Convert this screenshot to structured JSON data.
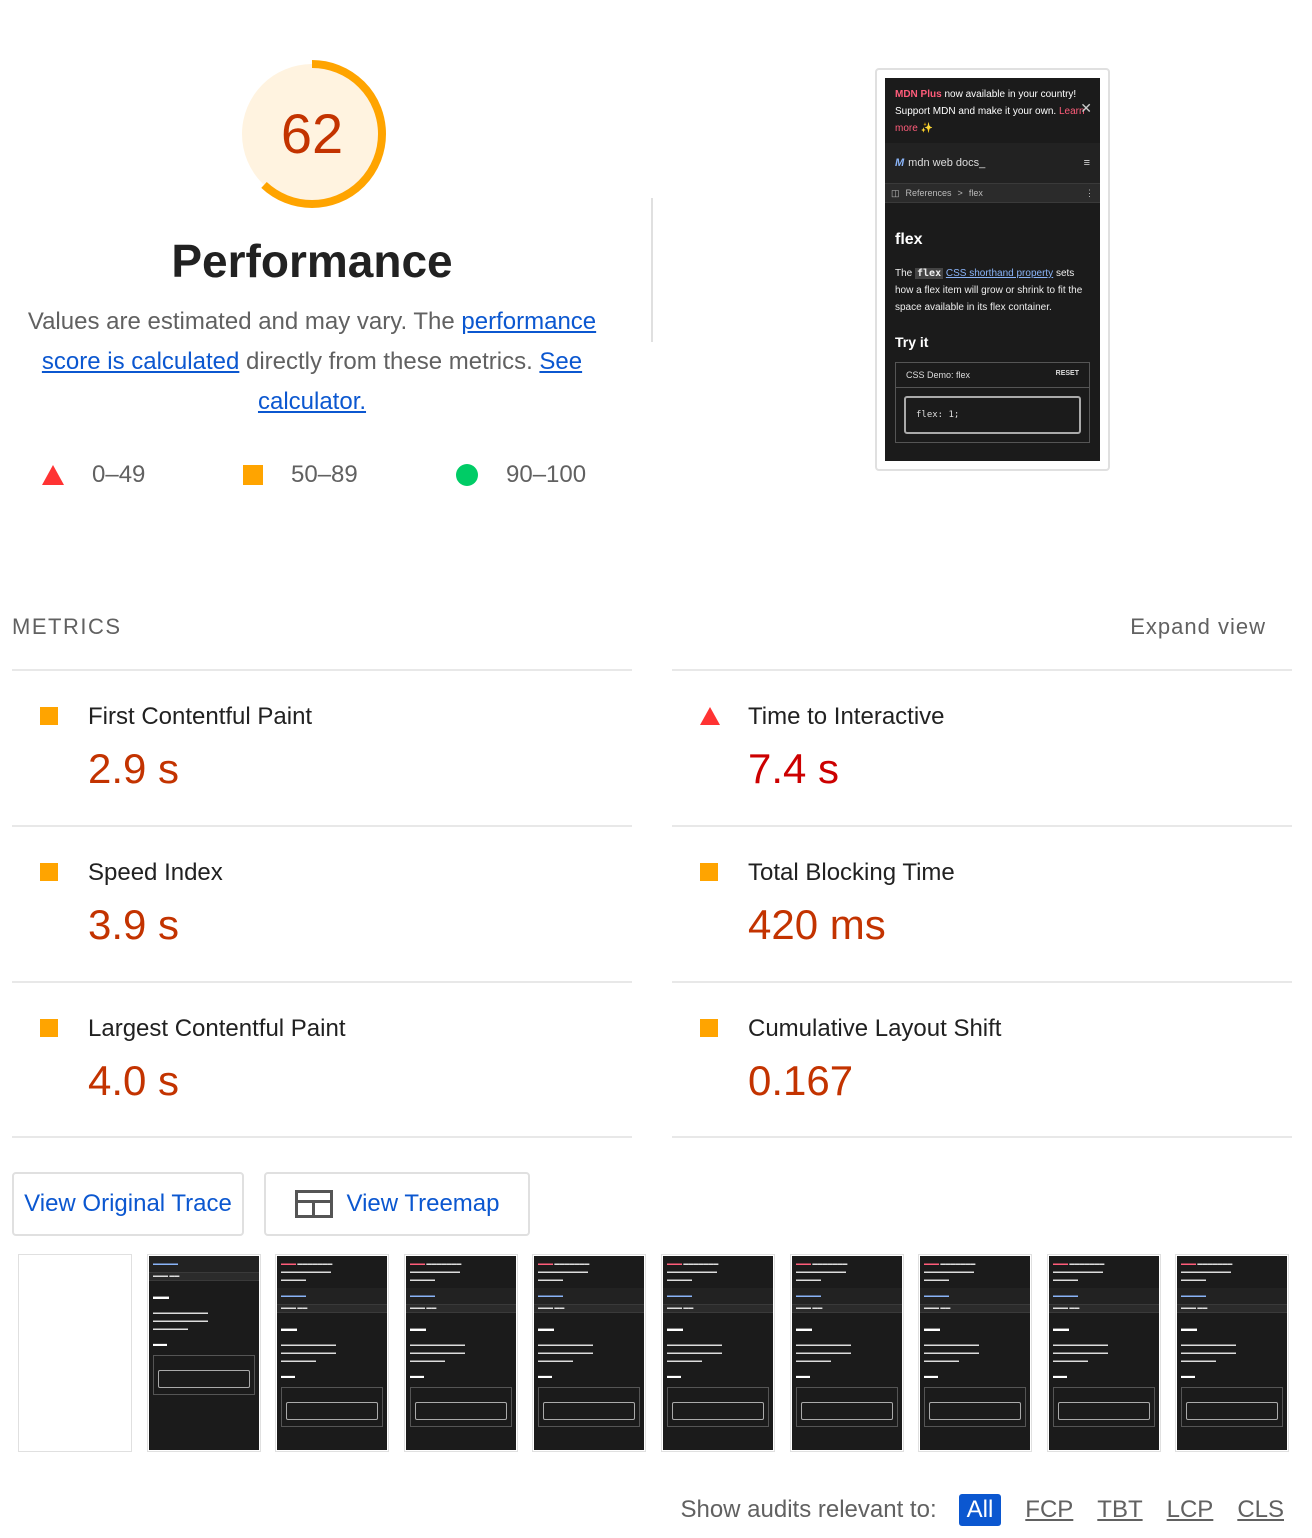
{
  "summary": {
    "score": "62",
    "score_fraction": 0.62,
    "title": "Performance",
    "desc_prefix": "Values are estimated and may vary. The ",
    "desc_link1": "performance score is calculated",
    "desc_middle": " directly from these metrics. ",
    "desc_link2": "See calculator."
  },
  "legend": [
    {
      "icon": "red-triangle",
      "range": "0–49"
    },
    {
      "icon": "orange-square",
      "range": "50–89"
    },
    {
      "icon": "green-circle",
      "range": "90–100"
    }
  ],
  "final_screenshot": {
    "banner_brand": "MDN Plus",
    "banner_text": " now available in your country! Support MDN and make it your own. ",
    "banner_link": "Learn more ✨",
    "close": "✕",
    "logo": "M",
    "logo_text": "mdn web docs_",
    "menu": "≡",
    "crumb_icon": "◫",
    "crumb_1": "References",
    "crumb_sep": ">",
    "crumb_2": "flex",
    "crumb_more": "⋮",
    "heading": "flex",
    "para_pre": "The ",
    "para_code": "flex",
    "para_link": "CSS shorthand property",
    "para_post": " sets how a flex item will grow or shrink to fit the space available in its flex container.",
    "try_it": "Try it",
    "demo_title": "CSS Demo: flex",
    "demo_reset": "RESET",
    "demo_code": "flex: 1;"
  },
  "metrics": {
    "section_label": "METRICS",
    "expand_label": "Expand view",
    "items": [
      {
        "name": "First Contentful Paint",
        "value": "2.9 s",
        "status": "average"
      },
      {
        "name": "Time to Interactive",
        "value": "7.4 s",
        "status": "fail"
      },
      {
        "name": "Speed Index",
        "value": "3.9 s",
        "status": "average"
      },
      {
        "name": "Total Blocking Time",
        "value": "420 ms",
        "status": "average"
      },
      {
        "name": "Largest Contentful Paint",
        "value": "4.0 s",
        "status": "average"
      },
      {
        "name": "Cumulative Layout Shift",
        "value": "0.167",
        "status": "average"
      }
    ]
  },
  "buttons": {
    "trace": "View Original Trace",
    "treemap": "View Treemap"
  },
  "filmstrip": {
    "frame_count": 10
  },
  "audit_filter": {
    "label": "Show audits relevant to:",
    "chips": [
      "All",
      "FCP",
      "TBT",
      "LCP",
      "CLS"
    ],
    "active": "All"
  },
  "colors": {
    "average": "#ffa400",
    "fail": "#ff3333",
    "pass": "#00cc66",
    "average_text": "#c33300",
    "fail_text": "#cc0000",
    "link": "#0b57d0"
  }
}
